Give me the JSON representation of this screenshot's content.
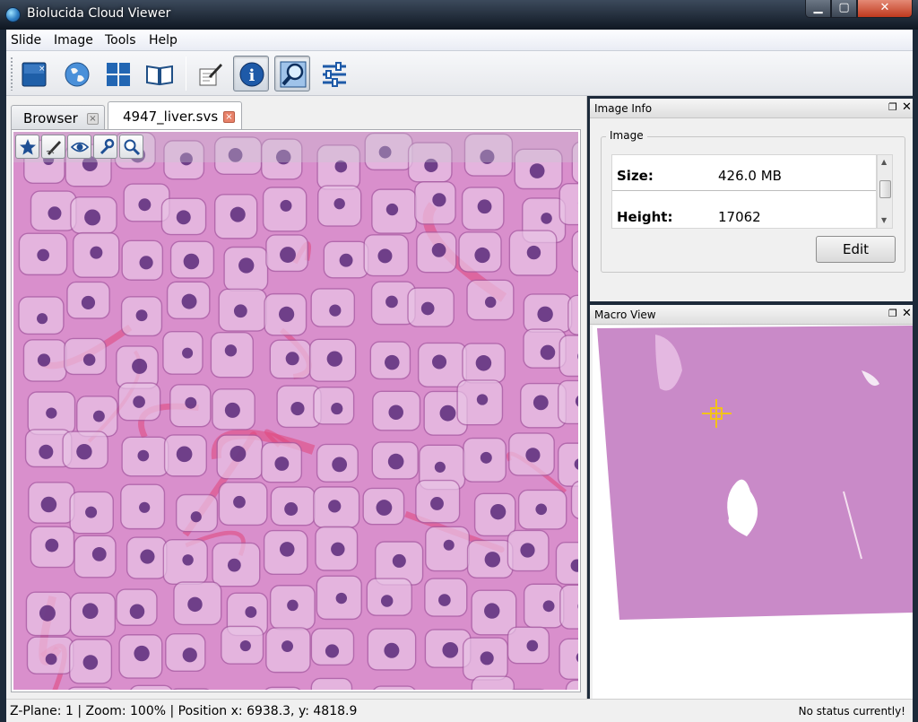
{
  "window": {
    "title": "Biolucida Cloud Viewer",
    "app_icon": "globe-icon",
    "minimize_label": "▁",
    "maximize_label": "▢",
    "close_label": "✕"
  },
  "menu": [
    "Slide",
    "Image",
    "Tools",
    "Help"
  ],
  "toolbar": {
    "buttons": [
      {
        "icon": "close-slide-icon",
        "active": false
      },
      {
        "icon": "globe-icon",
        "active": false
      },
      {
        "icon": "tile-grid-icon",
        "active": false
      },
      {
        "icon": "book-icon",
        "active": false
      },
      {
        "icon": "annotate-icon",
        "active": false
      },
      {
        "icon": "info-icon",
        "active": true
      },
      {
        "icon": "magnify-icon",
        "active": true
      },
      {
        "icon": "sliders-icon",
        "active": false
      }
    ]
  },
  "tabs": [
    {
      "label": "Browser",
      "close": "×",
      "selected": false
    },
    {
      "label": "4947_liver.svs",
      "close": "×",
      "selected": true
    }
  ],
  "viewer_tools": [
    "star-icon",
    "pen-icon",
    "eye-icon",
    "wrench-icon",
    "magnify-icon"
  ],
  "image_info": {
    "title": "Image Info",
    "group": "Image",
    "rows": [
      {
        "key": "Size:",
        "value": "426.0 MB"
      },
      {
        "key": "Height:",
        "value": "17062"
      }
    ],
    "edit_label": "Edit"
  },
  "macro_view": {
    "title": "Macro View"
  },
  "dock_float": "❐",
  "dock_close": "✕",
  "status": {
    "left": "Z-Plane: 1  |  Zoom: 100%  |  Position x: 6938.3, y: 4818.9",
    "right": "No status currently!"
  },
  "colors": {
    "tissue": "#d98fcc",
    "nucleus": "#5a2a7a",
    "eosin": "#e0457a",
    "macro_tissue": "#c98ac8",
    "crosshair": "#f2c21b"
  }
}
